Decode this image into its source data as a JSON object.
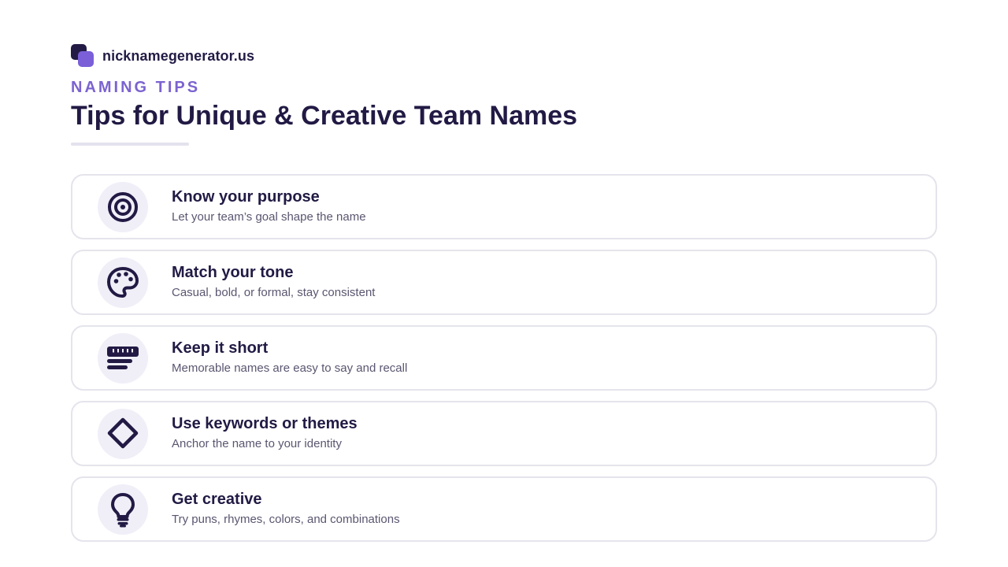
{
  "brand": {
    "name": "nicknamegenerator.us",
    "logo_icon": "stacked-squares-logo-icon",
    "logo_colors": [
      "#231b45",
      "#7a5fd8"
    ]
  },
  "header": {
    "eyebrow": "NAMING TIPS",
    "title": "Tips for Unique & Creative Team Names"
  },
  "colors": {
    "primary": "#221a44",
    "accent": "#7c63d0",
    "muted_text": "#5a5670",
    "card_border": "#e4e4ec",
    "icon_bg": "#f0eff8"
  },
  "tips": [
    {
      "icon": "target-icon",
      "title": "Know your purpose",
      "description": "Let your team’s goal shape the name"
    },
    {
      "icon": "palette-icon",
      "title": "Match your tone",
      "description": "Casual, bold, or formal, stay consistent"
    },
    {
      "icon": "ruler-icon",
      "title": "Keep it short",
      "description": "Memorable names are easy to say and recall"
    },
    {
      "icon": "diamond-icon",
      "title": "Use keywords or themes",
      "description": "Anchor the name to your identity"
    },
    {
      "icon": "lightbulb-icon",
      "title": "Get creative",
      "description": "Try puns, rhymes, colors, and combinations"
    }
  ]
}
